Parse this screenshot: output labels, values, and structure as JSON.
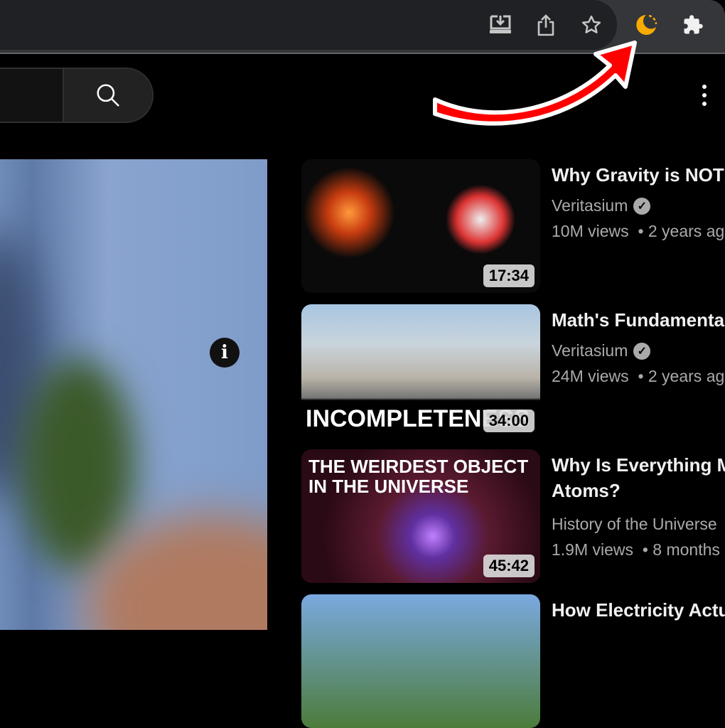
{
  "browser": {
    "icons": [
      "install-app-icon",
      "share-icon",
      "bookmark-star-icon",
      "dark-reader-moon-icon",
      "extensions-puzzle-icon"
    ],
    "accent_moon": "#f9ab00"
  },
  "youtube": {
    "search_icon": "search-icon",
    "more_icon": "kebab-icon",
    "info_label": "i"
  },
  "annotation": {
    "arrow_color": "#ff0000"
  },
  "videos": [
    {
      "title": "Why Gravity is NOT",
      "channel": "Veritasium",
      "verified": true,
      "views": "10M views",
      "age": "• 2 years ag",
      "duration": "17:34",
      "thumb_text": ""
    },
    {
      "title": "Math's Fundamenta",
      "channel": "Veritasium",
      "verified": true,
      "views": "24M views",
      "age": "• 2 years ag",
      "duration": "34:00",
      "thumb_text": "INCOMPLETENESS"
    },
    {
      "title": "Why Is Everything M",
      "title_line2": "Atoms?",
      "channel": "History of the Universe",
      "verified": false,
      "views": "1.9M views",
      "age": "• 8 months",
      "duration": "45:42",
      "thumb_text": "THE WEIRDEST OBJECT IN THE UNIVERSE"
    },
    {
      "title": "How Electricity Actu"
    }
  ]
}
